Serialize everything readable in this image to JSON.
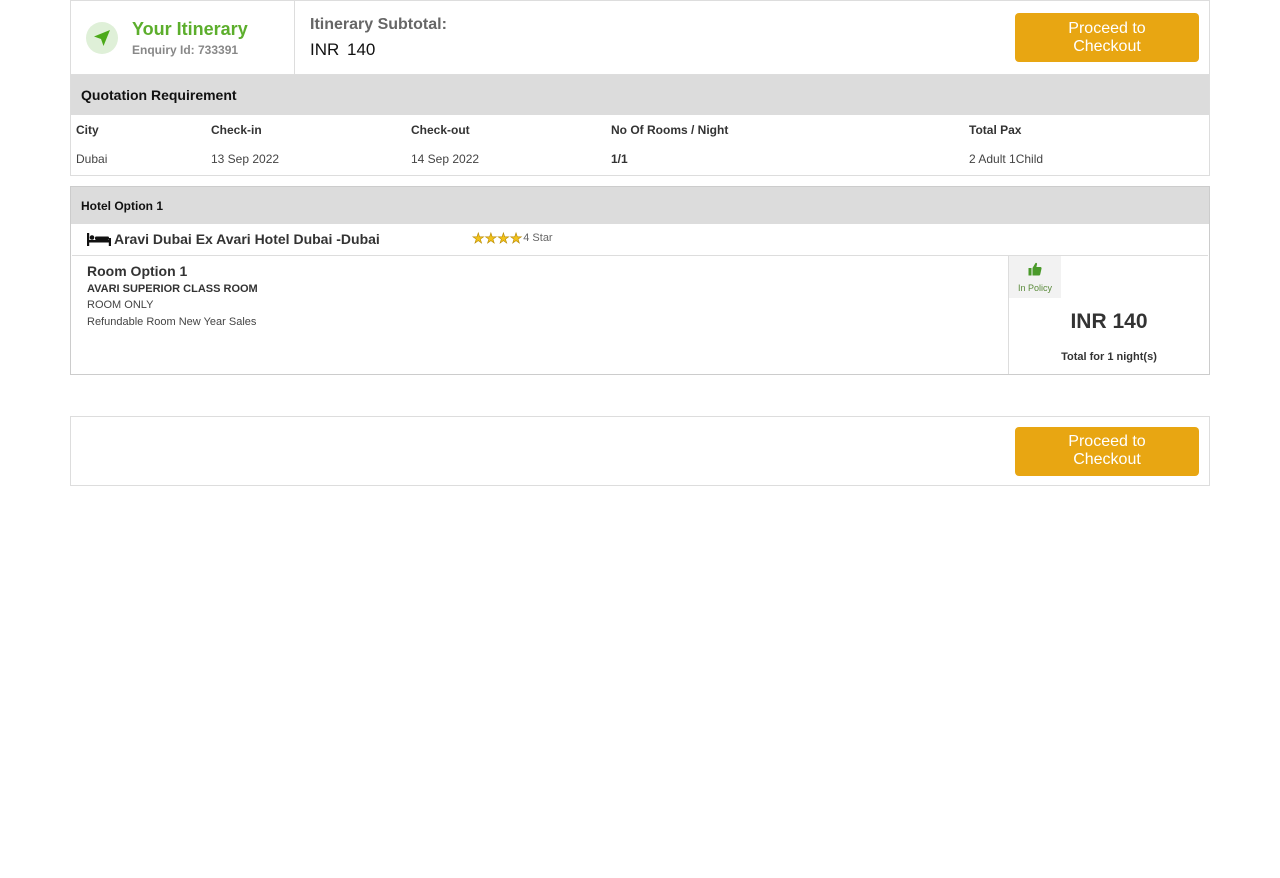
{
  "itinerary": {
    "title": "Your Itinerary",
    "enquiry": "Enquiry Id: 733391",
    "subtotal_label": "Itinerary Subtotal:",
    "subtotal_value": "INR 140",
    "checkout_label": "Proceed to Checkout"
  },
  "quotation": {
    "heading": "Quotation Requirement",
    "columns": [
      "City",
      "Check-in",
      "Check-out",
      "No Of Rooms / Night",
      "Total Pax"
    ],
    "values": [
      "Dubai",
      "13 Sep 2022",
      "14 Sep 2022",
      "1/1",
      "2 Adult 1Child"
    ]
  },
  "hotel": {
    "option_label": "Hotel Option 1",
    "name": "Aravi Dubai Ex Avari Hotel Dubai -Dubai",
    "star_count": 4,
    "star_label": "4 Star",
    "room": {
      "title": "Room Option 1",
      "type": "AVARI SUPERIOR CLASS ROOM",
      "meal": "ROOM ONLY",
      "note": "Refundable Room New Year Sales"
    },
    "policy_label": "In Policy",
    "price": "INR 140",
    "nights": "Total for 1 night(s)"
  },
  "bottom": {
    "checkout_label": "Proceed to Checkout"
  },
  "colors": {
    "accent": "#e8a612",
    "brand_green": "#5cae2c"
  }
}
